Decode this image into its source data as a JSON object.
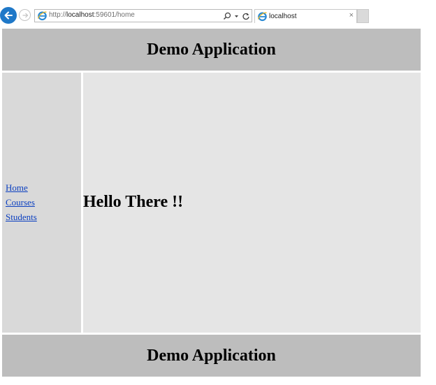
{
  "browser": {
    "address_prefix": "http://",
    "address_host": "localhost",
    "address_suffix": ":59601/home",
    "tab_title": "localhost",
    "tab_close": "×"
  },
  "app": {
    "header_title": "Demo Application",
    "footer_title": "Demo Application"
  },
  "sidebar": {
    "items": [
      {
        "label": "Home"
      },
      {
        "label": "Courses"
      },
      {
        "label": "Students"
      }
    ]
  },
  "main": {
    "heading": "Hello There !!"
  },
  "colors": {
    "header_bg": "#bdbdbd",
    "sidebar_bg": "#d9d9d9",
    "content_bg": "#e5e5e5",
    "link": "#0b3fc0",
    "back_button": "#1f78c8"
  }
}
